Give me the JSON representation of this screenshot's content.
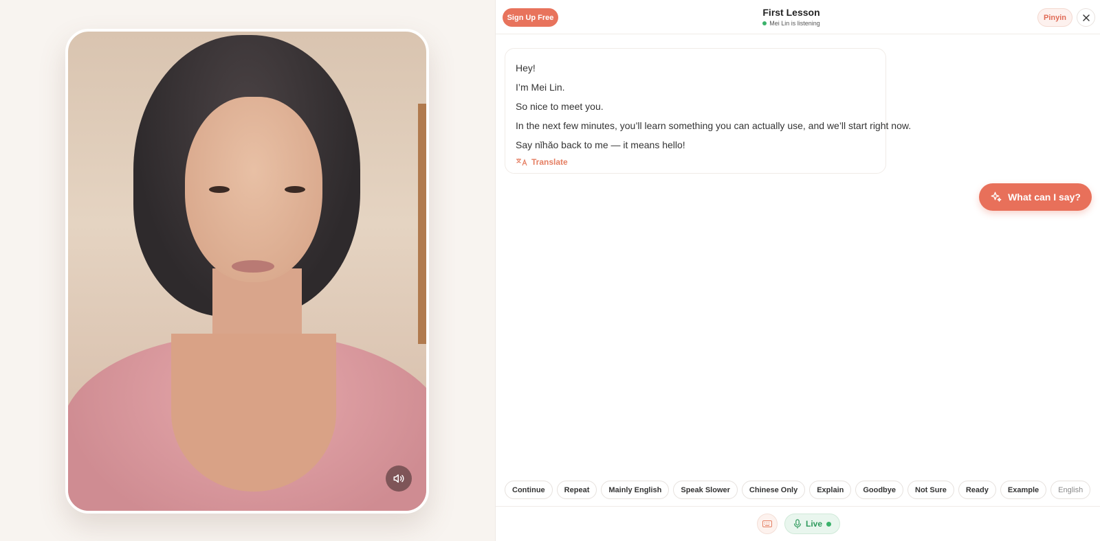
{
  "header": {
    "signup_label": "Sign Up Free",
    "title": "First Lesson",
    "status": "Mei Lin is listening",
    "pinyin_label": "Pinyin"
  },
  "message": {
    "lines": [
      "Hey!",
      "I’m Mei Lin.",
      "So nice to meet you.",
      "In the next few minutes, you’ll learn something you can actually use, and we’ll start right now.",
      "Say nǐhǎo back to me — it means hello!"
    ],
    "translate_label": "Translate"
  },
  "what_can_i_say_label": "What can I say?",
  "chips": [
    "Continue",
    "Repeat",
    "Mainly English",
    "Speak Slower",
    "Chinese Only",
    "Explain",
    "Goodbye",
    "Not Sure",
    "Ready",
    "Example",
    "English"
  ],
  "footer": {
    "live_label": "Live"
  },
  "icons": {
    "mute": "speaker-icon",
    "close": "close-icon",
    "translate": "translate-icon",
    "sparkle": "sparkle-icon",
    "keyboard": "keyboard-icon",
    "mic": "mic-icon"
  },
  "colors": {
    "accent": "#e8705a",
    "live_green": "#3bb26b"
  }
}
